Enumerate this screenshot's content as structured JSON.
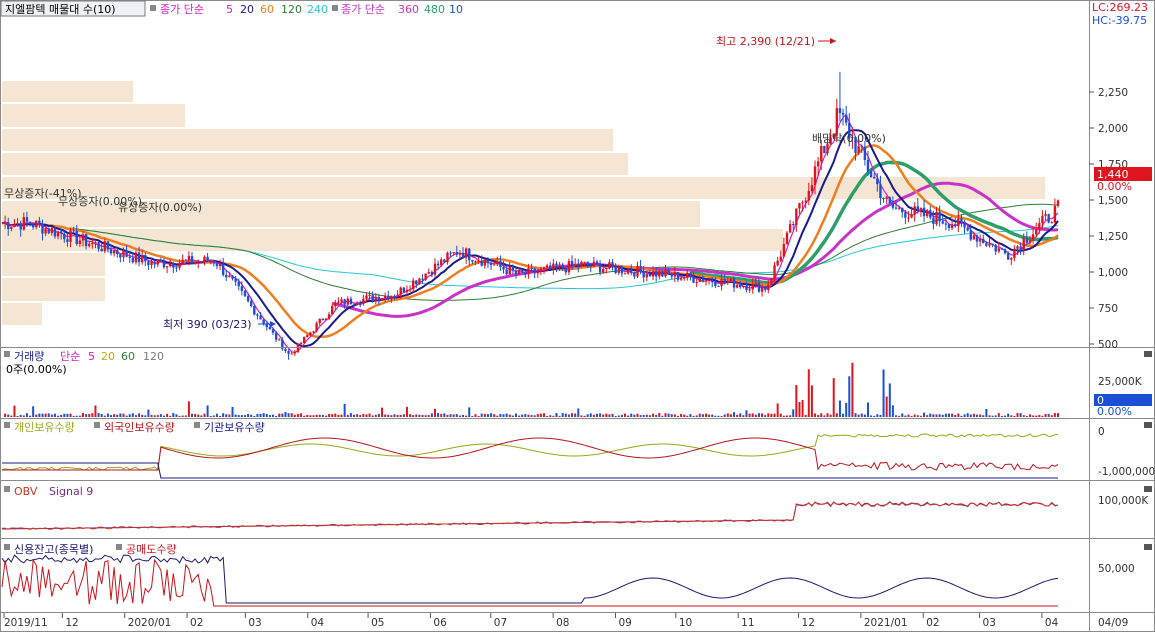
{
  "colors": {
    "background": "#ffffff",
    "up": "#e0141e",
    "down": "#1a4fd6",
    "volume_profile": "#f5e6d3",
    "ma5": "#d11fc0",
    "ma20": "#1a1a8c",
    "ma60": "#f07d1e",
    "ma120": "#2e7d32",
    "ma240": "#26c6da",
    "ma360": "#c832c8",
    "ma480": "#2e9e6a",
    "individual": "#9aa71a",
    "foreign": "#b8141e",
    "institution": "#1a1a8c",
    "obv": "#c8361e",
    "signal": "#7d2a8c",
    "credit": "#1a1a6e",
    "short": "#c8141e",
    "price_tag": "#e0141e",
    "volume_tag": "#1a4fd6"
  },
  "price_panel": {
    "title": "지엘팜텍 매물대 수(10)",
    "ma_group1_label": "종가 단순",
    "ma_group1_periods": [
      "5",
      "20",
      "60",
      "120",
      "240"
    ],
    "ma_group2_label": "종가 단순",
    "ma_group2_periods": [
      "360",
      "480",
      "10"
    ],
    "lc_label": "LC:269.23",
    "hc_label": "HC:-39.75",
    "price_tag": "1,440",
    "pct_tag": "0.00%",
    "high_annotation": "최고 2,390 (12/21)",
    "low_annotation": "최저 390 (03/23)",
    "events": [
      {
        "text": "무상증자(0.00%)"
      },
      {
        "text": "유상증자(0.00%)"
      },
      {
        "text": "배당락(0.00%)"
      }
    ],
    "event_partial": "무상증자(-41%)",
    "y_ticks": [
      "2,250",
      "2,000",
      "1,750",
      "1,500",
      "1,250",
      "1,000",
      "750",
      "500"
    ]
  },
  "volume_panel": {
    "title": "거래량",
    "ma_label": "단순",
    "ma_periods": [
      "5",
      "20",
      "60",
      "120"
    ],
    "value_text": "0주(0.00%)",
    "tag_value": "0",
    "tag_pct": "0.00%",
    "y_ticks": [
      "25,000K"
    ]
  },
  "holdings_panel": {
    "series": [
      "개인보유수량",
      "외국인보유수량",
      "기관보유수량"
    ],
    "y_ticks": [
      "0",
      "-1,000,000"
    ]
  },
  "obv_panel": {
    "series": [
      "OBV",
      "Signal 9"
    ],
    "y_ticks": [
      "100,000K"
    ]
  },
  "credit_panel": {
    "series": [
      "신용잔고(종목별)",
      "공매도수량"
    ],
    "y_ticks": [
      "50,000"
    ]
  },
  "x_axis": {
    "ticks": [
      "2019/11",
      "12",
      "2020/01",
      "02",
      "03",
      "04",
      "05",
      "06",
      "07",
      "08",
      "09",
      "10",
      "11",
      "12",
      "2021/01",
      "02",
      "03",
      "04"
    ],
    "right_label": "04/09"
  },
  "chart_data": {
    "type": "candlestick",
    "title": "지엘팜텍 매물대 수(10)",
    "x_range": [
      "2019-11",
      "2021-04-09"
    ],
    "ylim": [
      250,
      2450
    ],
    "price_points": [
      {
        "date": "2019-11",
        "close": 1340
      },
      {
        "date": "2019-12",
        "close": 1200
      },
      {
        "date": "2020-01",
        "close": 1060
      },
      {
        "date": "2020-02",
        "close": 1080
      },
      {
        "date": "2020-03-23",
        "close": 420,
        "low": 390
      },
      {
        "date": "2020-04",
        "close": 780
      },
      {
        "date": "2020-05",
        "close": 850
      },
      {
        "date": "2020-06",
        "close": 1150
      },
      {
        "date": "2020-07",
        "close": 980
      },
      {
        "date": "2020-08",
        "close": 1050
      },
      {
        "date": "2020-09",
        "close": 1000
      },
      {
        "date": "2020-10",
        "close": 950
      },
      {
        "date": "2020-11",
        "close": 890
      },
      {
        "date": "2020-12-21",
        "close": 2100,
        "high": 2390
      },
      {
        "date": "2021-01",
        "close": 1450
      },
      {
        "date": "2021-02",
        "close": 1350
      },
      {
        "date": "2021-03",
        "close": 1120
      },
      {
        "date": "2021-04-09",
        "close": 1440
      }
    ],
    "moving_averages": [
      {
        "name": "5",
        "color": "#d11fc0"
      },
      {
        "name": "20",
        "color": "#1a1a8c"
      },
      {
        "name": "60",
        "color": "#f07d1e"
      },
      {
        "name": "120",
        "color": "#2e7d32"
      },
      {
        "name": "240",
        "color": "#26c6da"
      },
      {
        "name": "360",
        "color": "#c832c8"
      },
      {
        "name": "480",
        "color": "#2e9e6a"
      },
      {
        "name": "10"
      }
    ],
    "volume_profile_levels": 10,
    "volume_ma": [
      "5",
      "20",
      "60",
      "120"
    ]
  }
}
